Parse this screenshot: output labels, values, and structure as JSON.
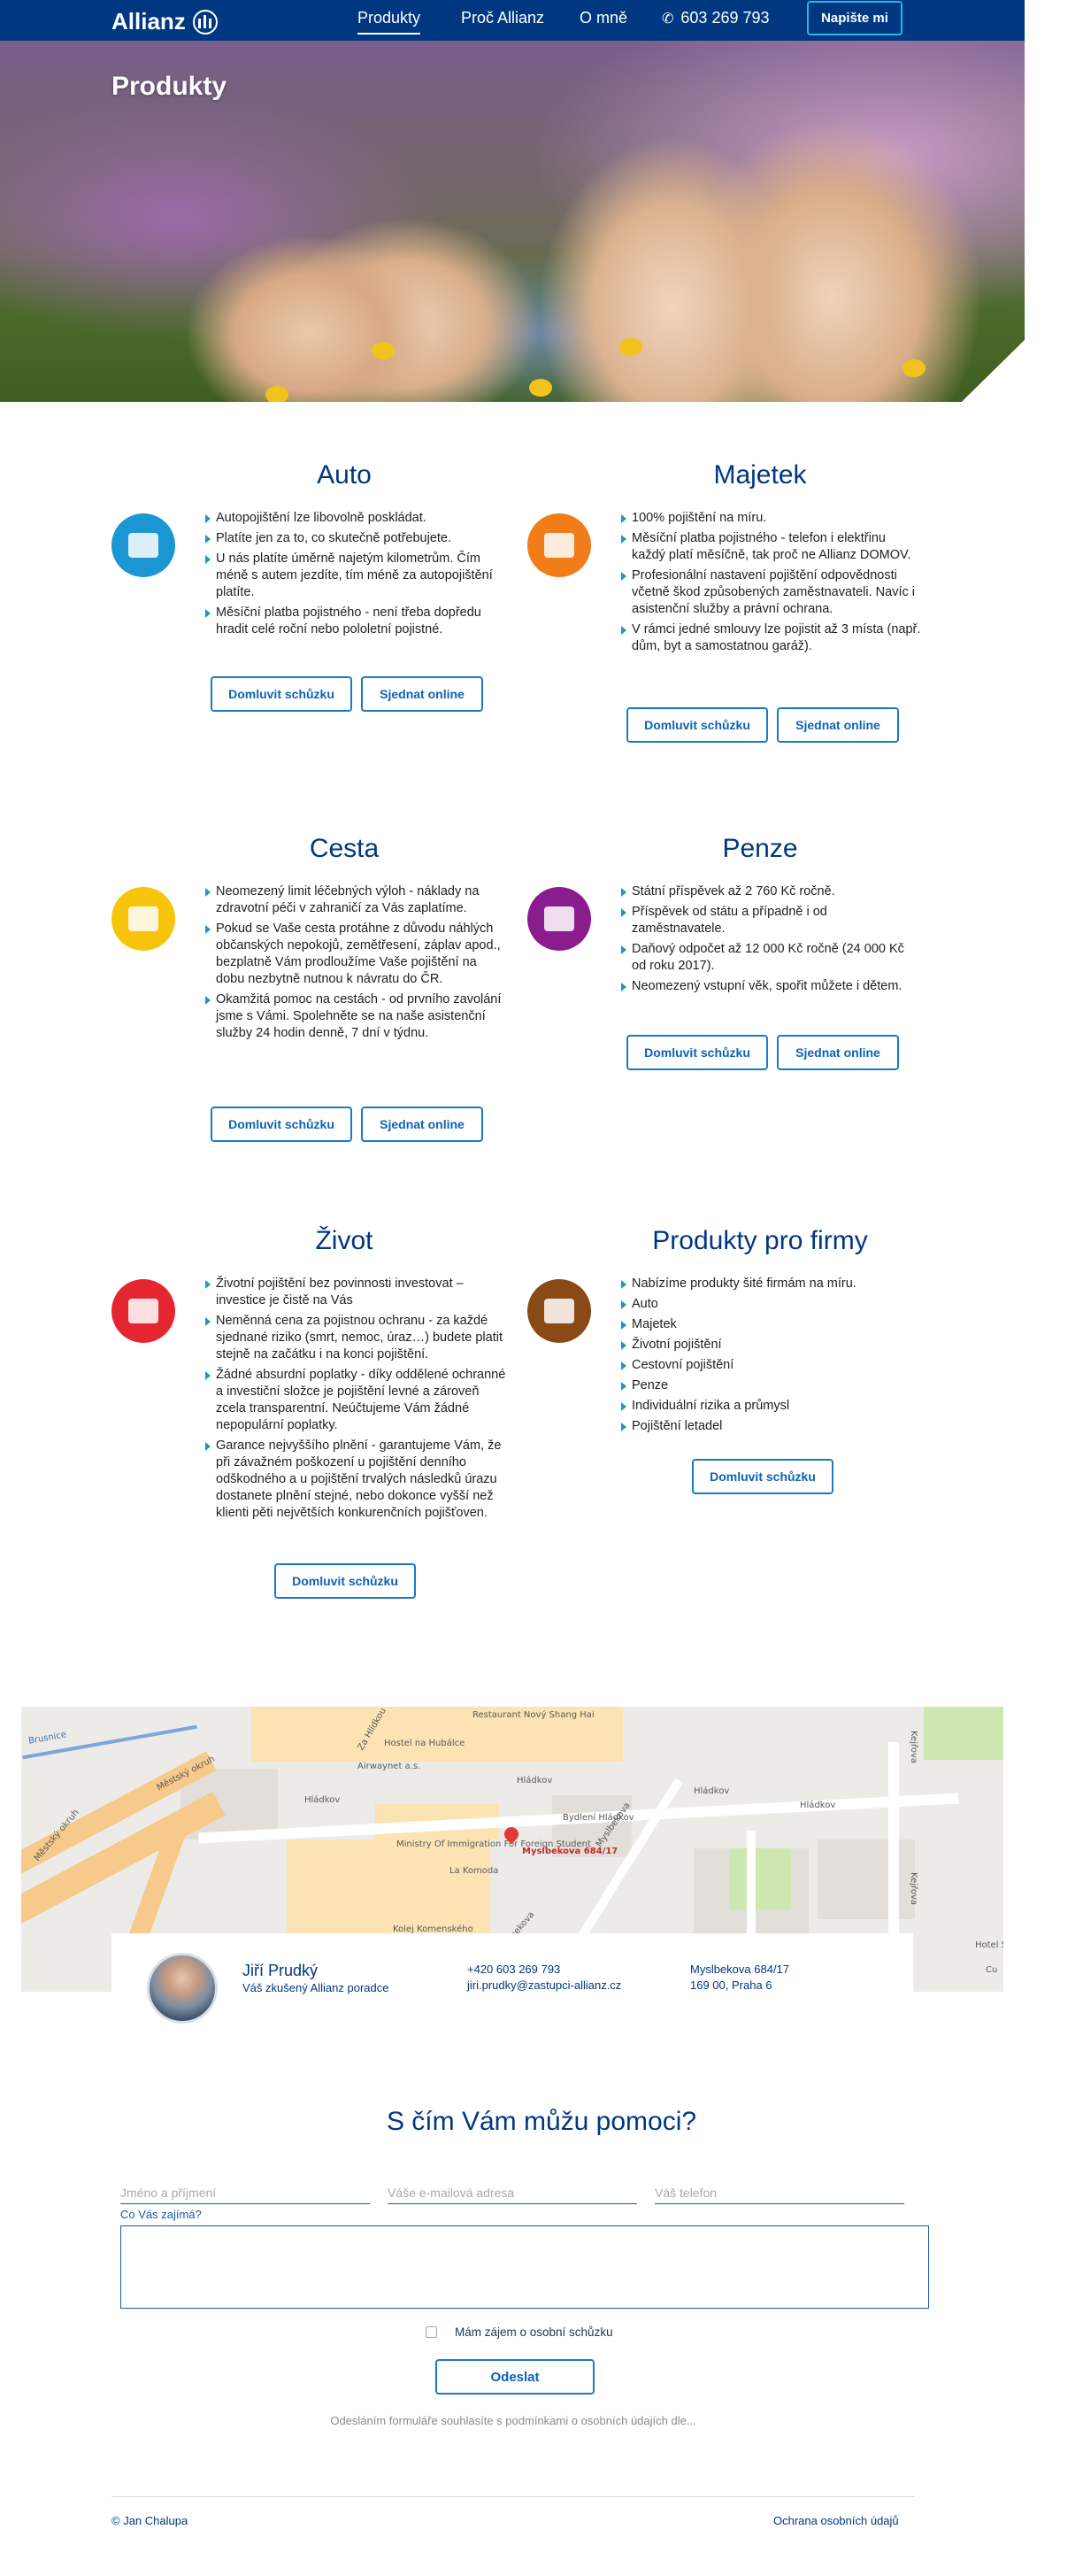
{
  "nav": {
    "logo": "Allianz",
    "links": [
      "Produkty",
      "Proč Allianz",
      "O mně"
    ],
    "phone": "603 269 793",
    "cta": "Napište mi"
  },
  "hero": {
    "title": "Produkty"
  },
  "products": [
    {
      "title": "Auto",
      "icon": "car-icon",
      "color": "#1a96d3",
      "items": [
        "Autopojištění lze libovolně poskládat.",
        "Platíte jen za to, co skutečně potřebujete.",
        "U nás platíte úměrně najetým kilometrům. Čím méně s autem jezdíte, tím méně za autopojištění platíte.",
        "Měsíční platba pojistného - není třeba dopředu hradit celé roční nebo pololetní pojistné."
      ],
      "buttons": [
        "Domluvit schůzku",
        "Sjednat online"
      ]
    },
    {
      "title": "Majetek",
      "icon": "house-icon",
      "color": "#f07d1a",
      "items": [
        "100% pojištění na míru.",
        "Měsíční platba pojistného - telefon i elektřinu každý platí měsíčně, tak proč ne Allianz DOMOV.",
        "Profesionální nastavení pojištění odpovědnosti včetně škod způsobených zaměstnavateli. Navíc i asistenční služby a právní ochrana.",
        "V rámci jedné smlouvy lze pojistit až 3 místa (např. dům, byt a samostatnou garáž)."
      ],
      "buttons": [
        "Domluvit schůzku",
        "Sjednat online"
      ]
    },
    {
      "title": "Cesta",
      "icon": "travel-icon",
      "color": "#f6c40a",
      "items": [
        "Neomezený limit léčebných výloh - náklady na zdravotní péči v zahraničí za Vás zaplatíme.",
        "Pokud se Vaše cesta protáhne z důvodu náhlých občanských nepokojů, zemětřesení, záplav apod., bezplatně Vám prodloužíme Vaše pojištění na dobu nezbytně nutnou k návratu do ČR.",
        "Okamžitá pomoc na cestách - od prvního zavolání jsme s Vámi. Spolehněte se na naše asistenční služby 24 hodin denně, 7 dní v týdnu."
      ],
      "buttons": [
        "Domluvit schůzku",
        "Sjednat online"
      ]
    },
    {
      "title": "Penze",
      "icon": "piggy-bank-icon",
      "color": "#8b1c8e",
      "items": [
        "Státní příspěvek až 2 760 Kč ročně.",
        "Příspěvek od státu a případně i od zaměstnavatele.",
        "Daňový odpočet až 12 000 Kč ročně (24 000 Kč od roku 2017).",
        "Neomezený vstupní věk, spořit můžete i dětem."
      ],
      "buttons": [
        "Domluvit schůzku",
        "Sjednat online"
      ]
    },
    {
      "title": "Život",
      "icon": "heart-icon",
      "color": "#e52631",
      "items": [
        "Životní pojištění bez povinnosti investovat – investice je čistě na Vás",
        "Neměnná cena za pojistnou ochranu - za každé sjednané riziko (smrt, nemoc, úraz…) budete platit stejně na začátku i na konci pojištění.",
        "Žádné absurdní poplatky - díky oddělené ochranné a investiční složce je pojištění levné a zároveň zcela transparentní. Neúčtujeme Vám žádné nepopulární poplatky.",
        "Garance nejvyššího plnění - garantujeme Vám, že při závažném poškození u pojištění denního odškodného a u pojištění trvalých následků úrazu dostanete plnění stejné, nebo dokonce vyšší než klienti pěti největších konkurenčních pojišťoven."
      ],
      "buttons": [
        "Domluvit schůzku"
      ]
    },
    {
      "title": "Produkty pro firmy",
      "icon": "company-icon",
      "color": "#8a4a16",
      "items": [
        "Nabízíme produkty šité firmám na míru.",
        "Auto",
        "Majetek",
        "Životní pojištění",
        "Cestovní pojištění",
        "Penze",
        "Individuální rizika a průmysl",
        "Pojištění letadel"
      ],
      "buttons": [
        "Domluvit schůzku"
      ]
    }
  ],
  "map": {
    "labels": [
      "Restaurant Nový Shang Hai",
      "Hostel na Hubálce",
      "Airwaynet a.s.",
      "Hládkov",
      "Hládkov",
      "Hládkov",
      "Hládkov",
      "Bydlení Hládkov",
      "Ministry Of Immigration For Foreign Student",
      "La Komoda",
      "Kolej Komenského",
      "Městský okruh",
      "Městský okruh",
      "Brusnice",
      "Myslbekova",
      "Myslbekova",
      "Kejřova",
      "Kejřova",
      "Hotel S",
      "Za Hlídkou",
      "Cu"
    ],
    "pin_label": "Myslbekova 684/17"
  },
  "contact": {
    "name": "Jiří Prudký",
    "role": "Váš zkušený Allianz poradce",
    "phone": "+420 603 269 793",
    "email": "jiri.prudky@zastupci-allianz.cz",
    "street": "Myslbekova 684/17",
    "city": "169 00, Praha 6"
  },
  "form": {
    "title": "S čím Vám můžu pomoci?",
    "name_placeholder": "Jméno a příjmení",
    "email_placeholder": "Váše e-mailová adresa",
    "phone_placeholder": "Váš telefon",
    "interest_label": "Co Vás zajímá?",
    "checkbox_label": "Mám zájem o osobní schůzku",
    "submit": "Odeslat",
    "consent": "Odesláním formuláře souhlasíte s podmínkami o osobních údajích dle..."
  },
  "footer": {
    "copyright": "© Jan Chalupa",
    "privacy": "Ochrana osobních údajů"
  }
}
